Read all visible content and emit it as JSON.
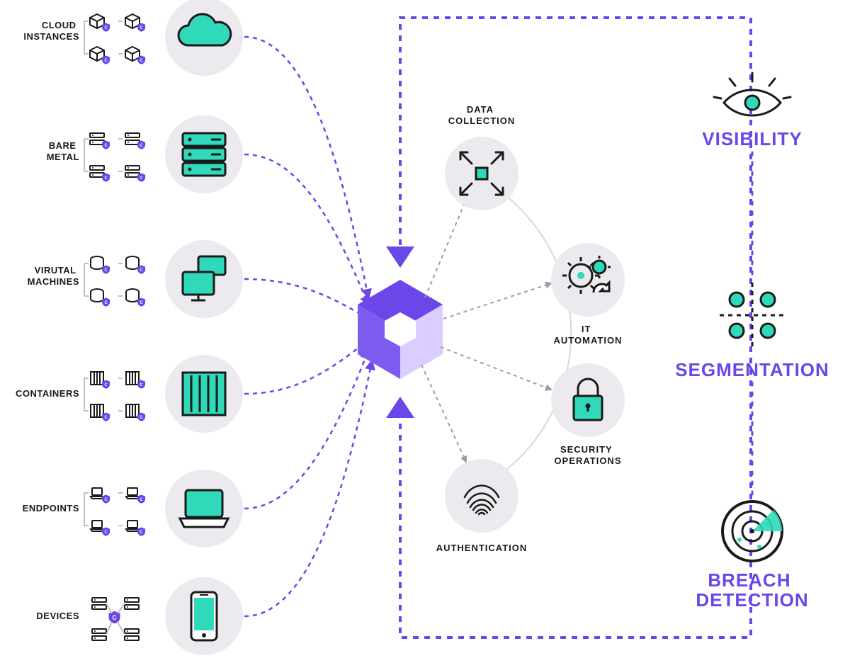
{
  "colors": {
    "purple": "#6b46e8",
    "purple_light": "#9b7ff0",
    "purple_pale": "#c9b8f7",
    "teal": "#2fd9b9",
    "grey_light": "#eceaee",
    "grey_mid": "#d9d6dd",
    "ink": "#1a1a1a"
  },
  "sources": [
    {
      "label_l1": "CLOUD",
      "label_l2": "INSTANCES",
      "icon": "cloud",
      "mini": "cube"
    },
    {
      "label_l1": "BARE",
      "label_l2": "METAL",
      "icon": "server",
      "mini": "rack"
    },
    {
      "label_l1": "VIRUTAL",
      "label_l2": "MACHINES",
      "icon": "desktop",
      "mini": "disk"
    },
    {
      "label_l1": "CONTAINERS",
      "label_l2": "",
      "icon": "container",
      "mini": "container-small"
    },
    {
      "label_l1": "ENDPOINTS",
      "label_l2": "",
      "icon": "laptop",
      "mini": "laptop-small"
    },
    {
      "label_l1": "DEVICES",
      "label_l2": "",
      "icon": "phone",
      "mini": "network"
    }
  ],
  "stages": [
    {
      "label_l1": "DATA",
      "label_l2": "COLLECTION",
      "icon": "collect"
    },
    {
      "label_l1": "IT",
      "label_l2": "AUTOMATION",
      "icon": "gears"
    },
    {
      "label_l1": "SECURITY",
      "label_l2": "OPERATIONS",
      "icon": "lock"
    },
    {
      "label_l1": "AUTHENTICATION",
      "label_l2": "",
      "icon": "fingerprint"
    }
  ],
  "outcomes": [
    {
      "label_l1": "VISIBILITY",
      "label_l2": "",
      "icon": "eye"
    },
    {
      "label_l1": "SEGMENTATION",
      "label_l2": "",
      "icon": "grid"
    },
    {
      "label_l1": "BREACH",
      "label_l2": "DETECTION",
      "icon": "radar"
    }
  ],
  "center": {
    "icon": "hex-logo"
  }
}
